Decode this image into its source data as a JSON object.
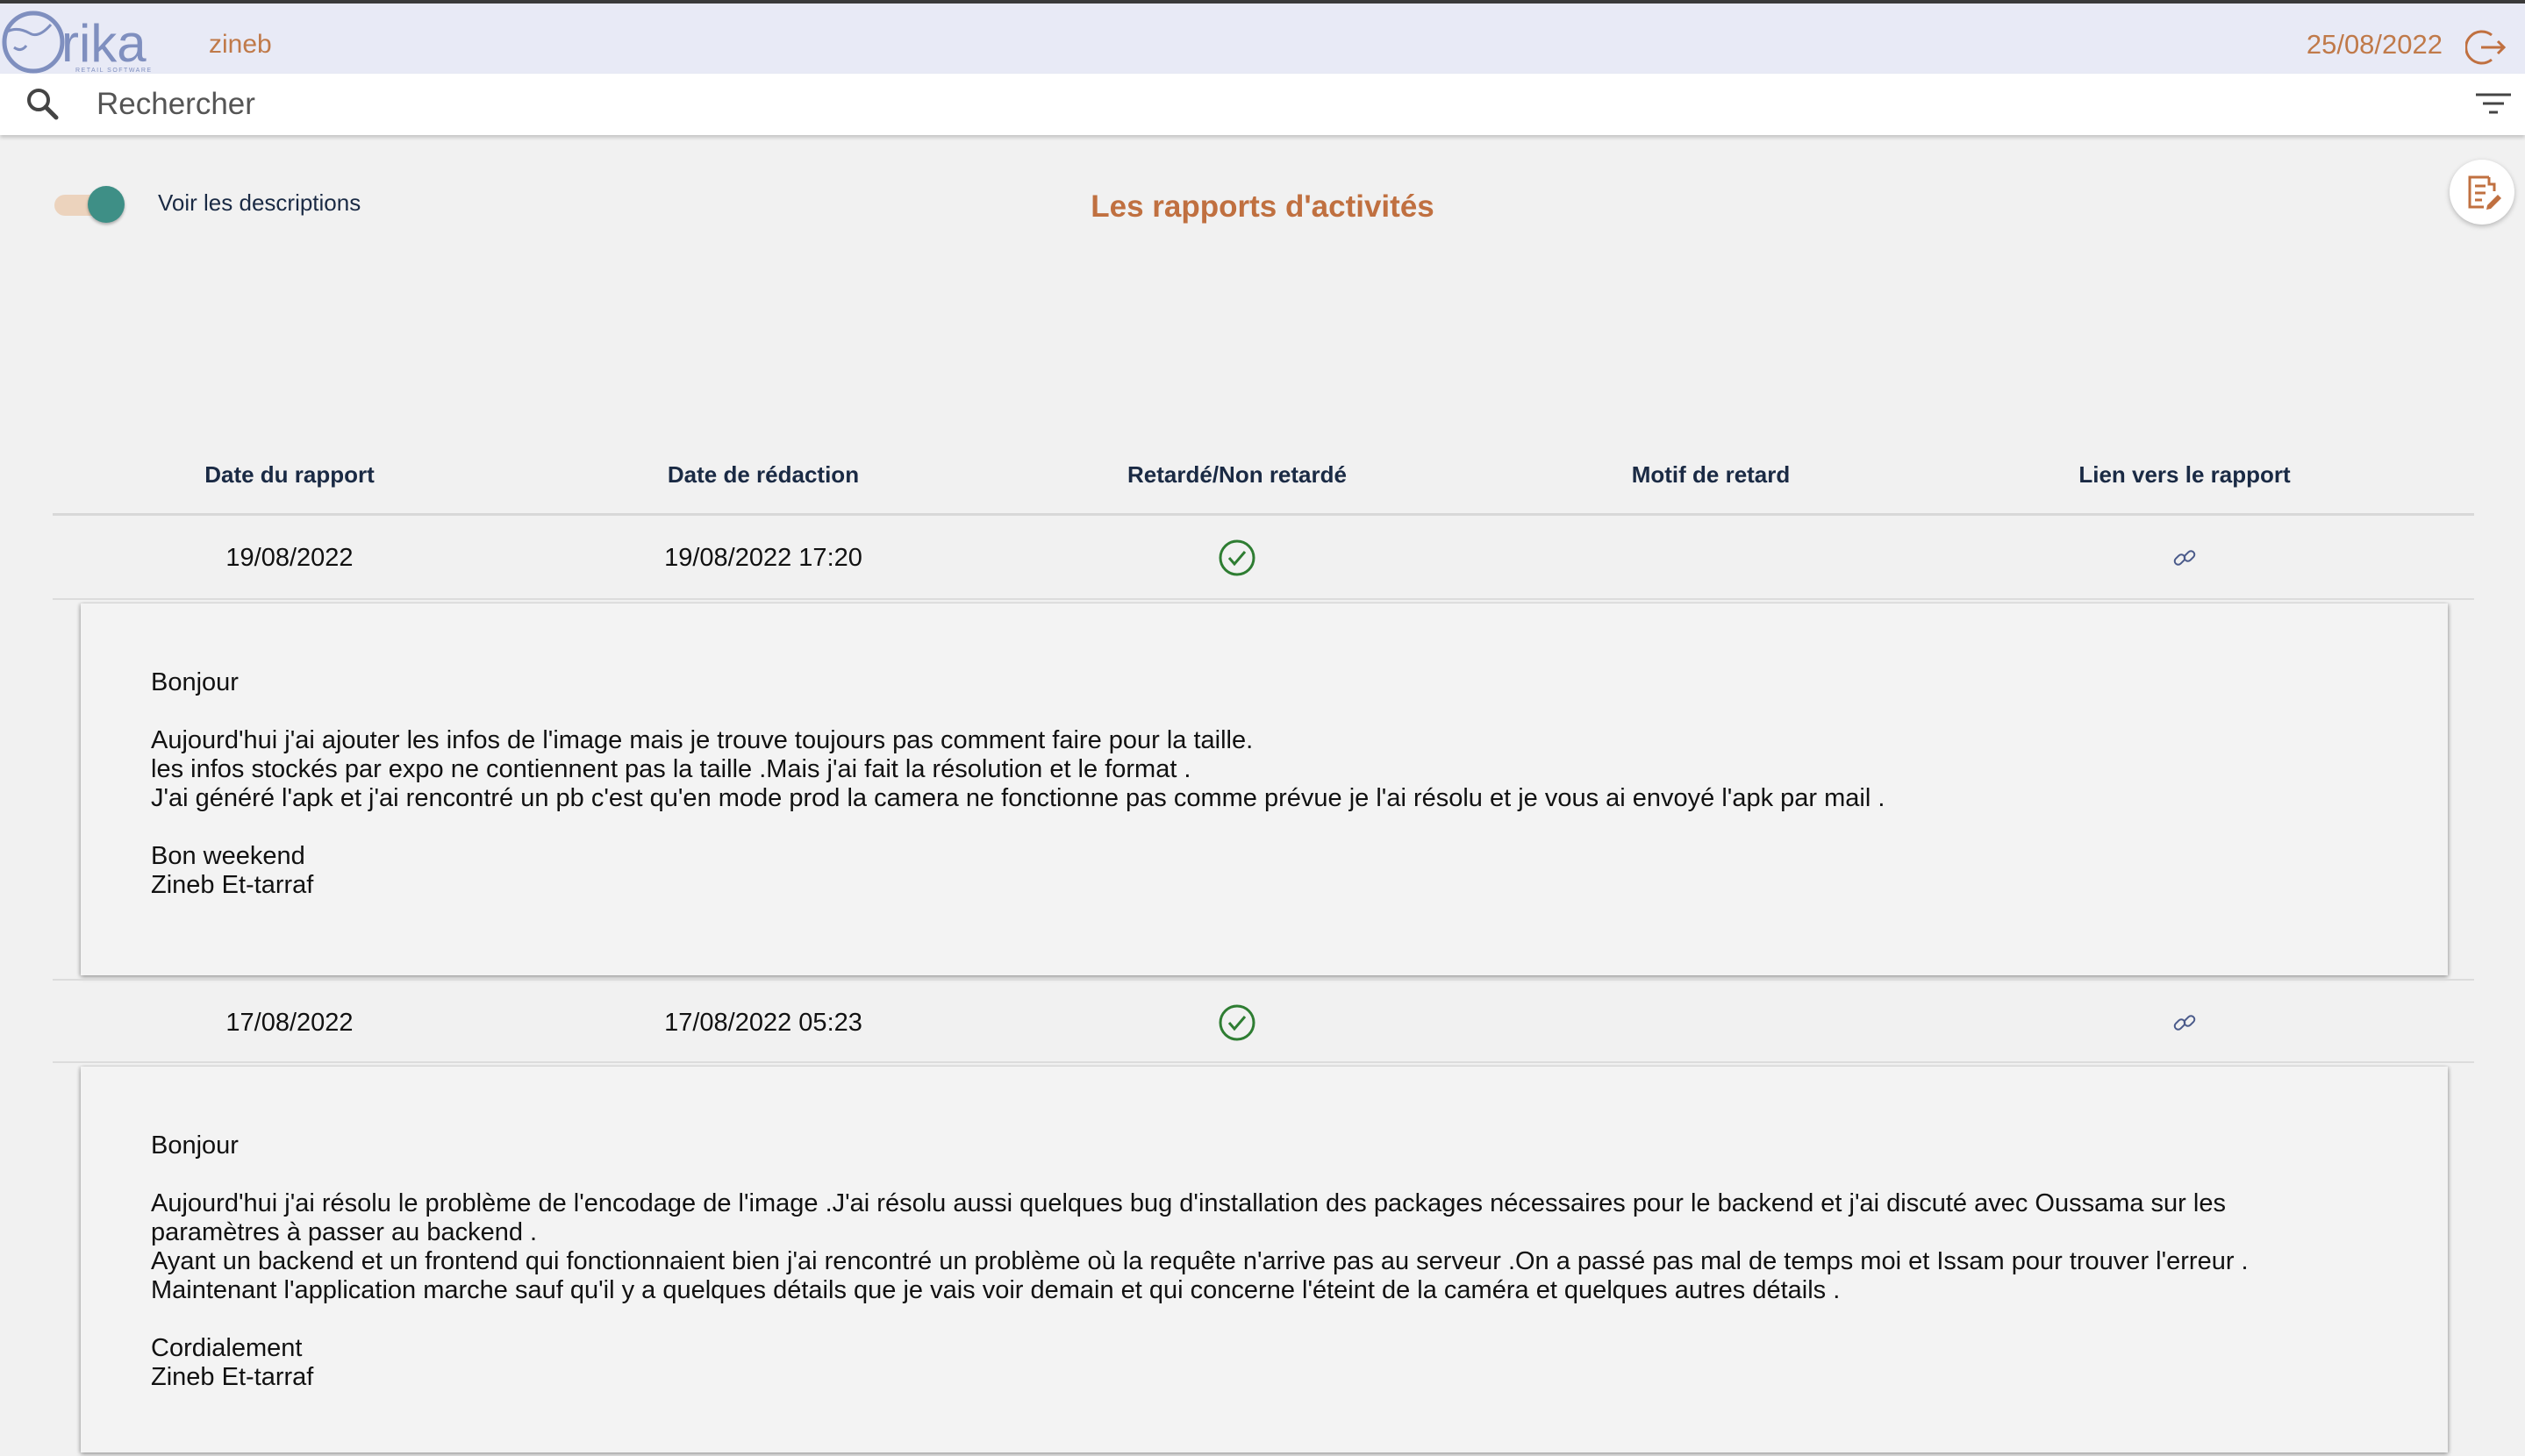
{
  "header": {
    "brand": "rika",
    "brand_tagline": "RETAIL SOFTWARE",
    "username": "zineb",
    "date": "25/08/2022"
  },
  "search": {
    "placeholder": "Rechercher"
  },
  "toolbar": {
    "toggle_label": "Voir les descriptions",
    "toggle_on": true,
    "page_title": "Les rapports d'activités"
  },
  "table": {
    "columns": [
      "Date du rapport",
      "Date de rédaction",
      "Retardé/Non retardé",
      "Motif de retard",
      "Lien vers le rapport"
    ],
    "rows": [
      {
        "report_date": "19/08/2022",
        "written_date": "19/08/2022 17:20",
        "late_status": "check-circle-icon",
        "late_reason": "",
        "link": "link-icon",
        "description": "Bonjour\n\nAujourd'hui j'ai ajouter les infos de l'image mais  je trouve toujours pas comment faire pour la taille.\nles infos stockés par expo ne contiennent pas la taille .Mais j'ai fait la résolution et le format .\nJ'ai généré l'apk et j'ai rencontré un pb c'est qu'en mode prod la camera ne fonctionne pas comme prévue je l'ai résolu et je vous ai envoyé l'apk par mail .\n\nBon weekend\nZineb Et-tarraf"
      },
      {
        "report_date": "17/08/2022",
        "written_date": "17/08/2022 05:23",
        "late_status": "check-circle-icon",
        "late_reason": "",
        "link": "link-icon",
        "description": "Bonjour\n\nAujourd'hui j'ai résolu le problème  de l'encodage de l'image .J'ai résolu aussi  quelques bug d'installation des packages nécessaires pour le backend et j'ai discuté avec Oussama sur les\nparamètres à passer au backend .\nAyant un backend et un frontend qui fonctionnaient bien j'ai rencontré un problème  où la requête n'arrive pas au serveur  .On a passé pas mal de temps moi et Issam pour trouver l'erreur .\nMaintenant l'application marche sauf qu'il y a quelques détails que je vais voir demain et qui concerne l'éteint de la caméra et quelques autres détails .\n\nCordialement\nZineb Et-tarraf"
      }
    ]
  },
  "colors": {
    "accent": "#c07040",
    "header_bg": "#e8eaf6",
    "toggle_knob": "#3e8f86",
    "toggle_track": "#ecd3bd",
    "check": "#2e7d32",
    "link": "#4a5a8a"
  }
}
